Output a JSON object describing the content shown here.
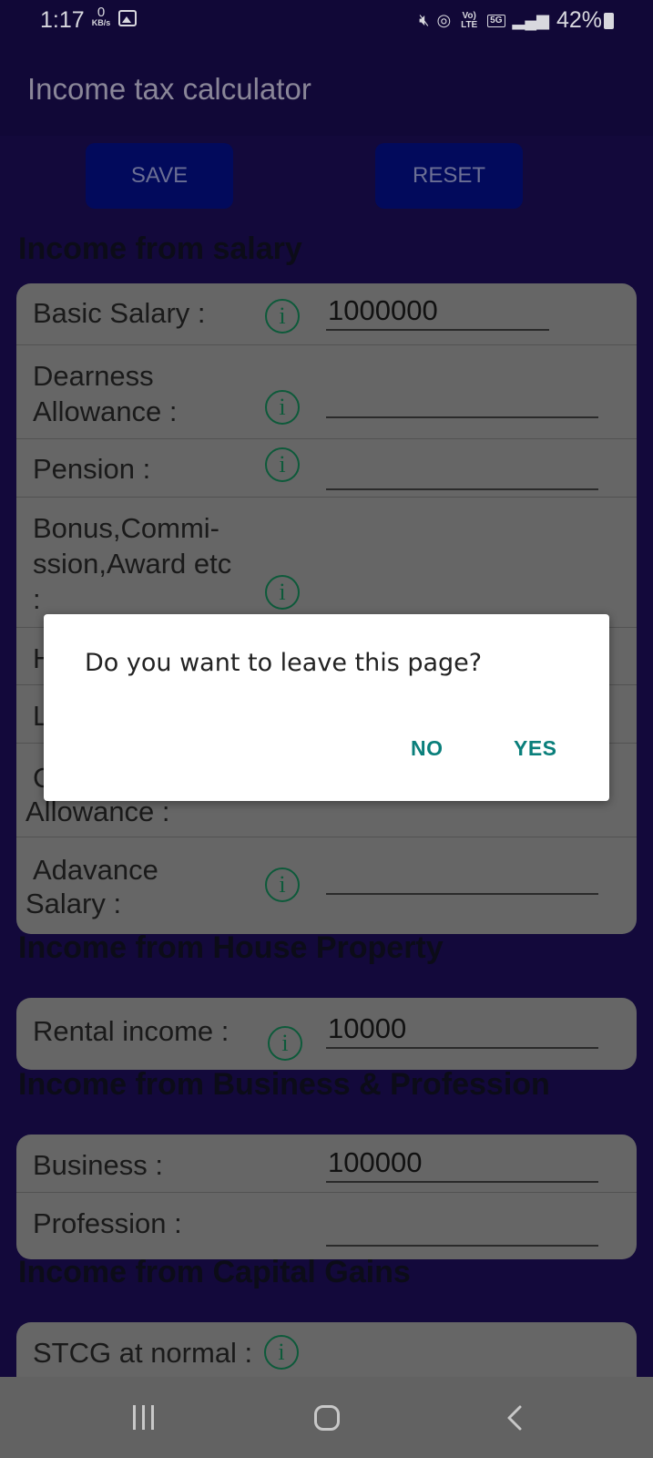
{
  "status_bar": {
    "time": "1:17",
    "data_rate_value": "0",
    "data_rate_unit": "KB/s",
    "volte": "Vo) LTE",
    "network": "5G",
    "battery": "42%"
  },
  "app": {
    "title": "Income tax calculator"
  },
  "toolbar": {
    "save_label": "SAVE",
    "reset_label": "RESET"
  },
  "sections": {
    "salary": {
      "title": "Income from salary",
      "basic_salary": {
        "label": "Basic Salary :",
        "value": "1000000"
      },
      "dearness_allowance": {
        "label": "Dearness Allowance :",
        "value": ""
      },
      "pension": {
        "label": "Pension :",
        "value": ""
      },
      "bonus": {
        "label": "Bonus,Commi-ssion,Award etc :",
        "value": ""
      },
      "partial_row_1": {
        "label": "H"
      },
      "partial_row_2": {
        "label": "L"
      },
      "other_allowance": {
        "label_top": "C",
        "label_bottom": "Allowance :"
      },
      "advance_salary": {
        "label": "Adavance Salary :",
        "value": ""
      }
    },
    "house_property": {
      "title": "Income from House Property",
      "rental_income": {
        "label": "Rental income :",
        "value": "10000"
      }
    },
    "business": {
      "title": "Income from Business & Profession",
      "business": {
        "label": "Business :",
        "value": "100000"
      },
      "profession": {
        "label": "Profession :",
        "value": ""
      }
    },
    "capital_gains": {
      "title": "Income from Capital Gains",
      "stcg_normal": {
        "label": "STCG at normal :"
      }
    }
  },
  "info_icon_glyph": "i",
  "dialog": {
    "message": "Do you want to leave this page?",
    "no_label": "NO",
    "yes_label": "YES"
  },
  "colors": {
    "background": "#13093b",
    "card": "#666666",
    "button": "#020a5c",
    "accent": "#0a7f7b",
    "info_icon": "#0d5a3a"
  }
}
